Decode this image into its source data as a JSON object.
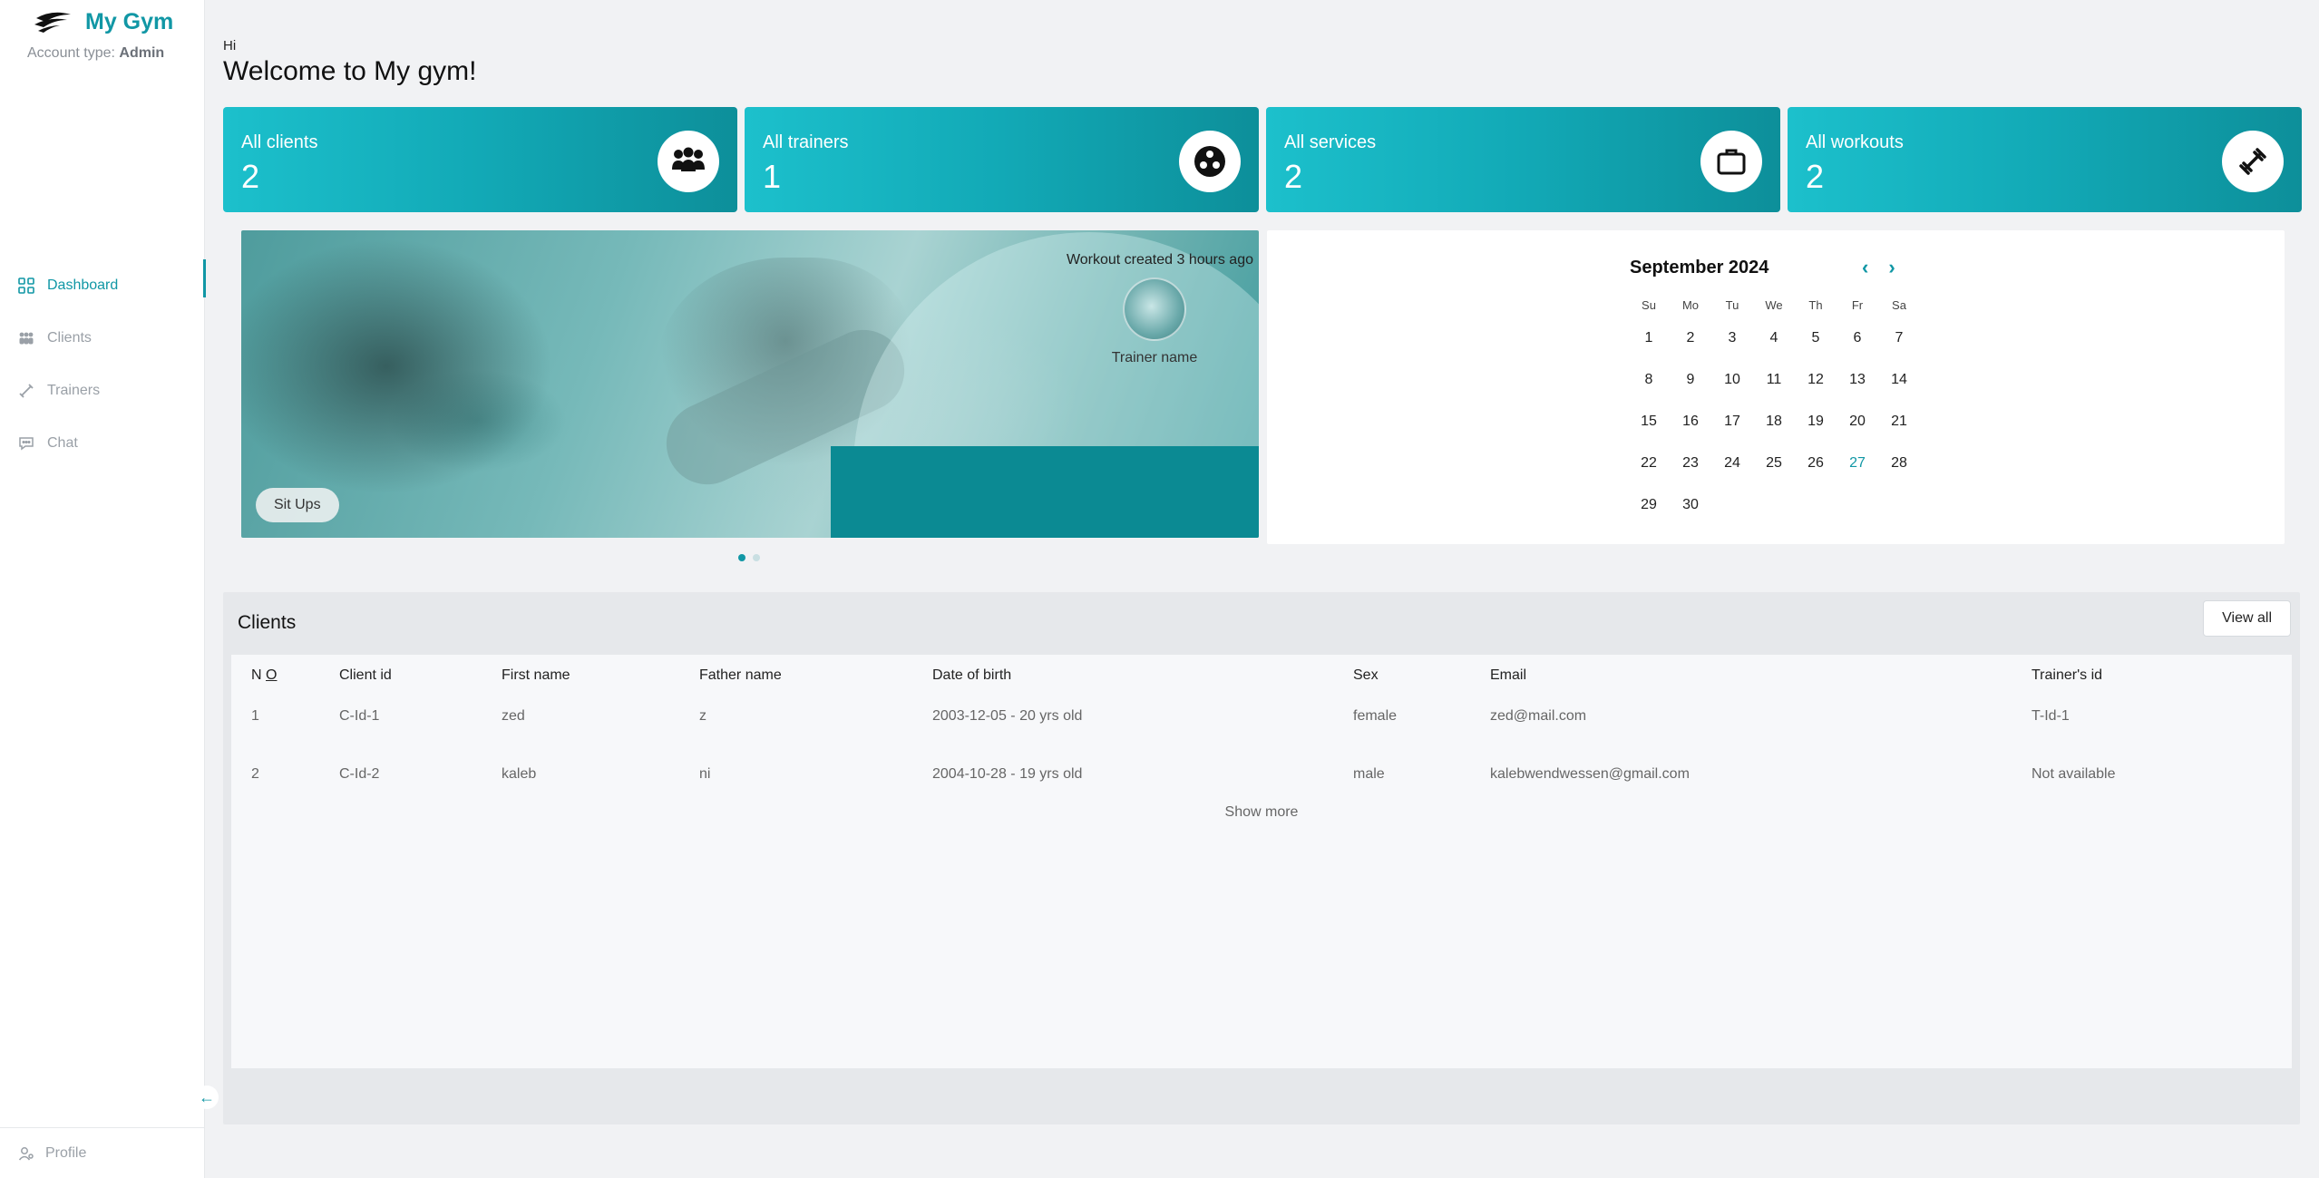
{
  "brand": {
    "title": "My Gym",
    "account_label": "Account type:",
    "account_type": "Admin"
  },
  "sidebar": {
    "items": [
      {
        "label": "Dashboard",
        "icon": "dashboard-icon",
        "active": true
      },
      {
        "label": "Clients",
        "icon": "clients-icon",
        "active": false
      },
      {
        "label": "Trainers",
        "icon": "dumbbell-icon",
        "active": false
      },
      {
        "label": "Chat",
        "icon": "chat-icon",
        "active": false
      }
    ],
    "profile_label": "Profile"
  },
  "header": {
    "greeting": "Hi",
    "welcome": "Welcome to My gym!"
  },
  "stats": [
    {
      "label": "All clients",
      "value": "2",
      "icon": "people-icon"
    },
    {
      "label": "All trainers",
      "value": "1",
      "icon": "trainer-icon"
    },
    {
      "label": "All services",
      "value": "2",
      "icon": "briefcase-icon"
    },
    {
      "label": "All workouts",
      "value": "2",
      "icon": "dumbbell-icon"
    }
  ],
  "workout_card": {
    "created": "Workout created 3 hours ago",
    "trainer_name": "Trainer name",
    "workout_name": "Sit Ups",
    "slides": 2,
    "active_slide": 1
  },
  "calendar": {
    "month_label": "September 2024",
    "weekdays": [
      "Su",
      "Mo",
      "Tu",
      "We",
      "Th",
      "Fr",
      "Sa"
    ],
    "days": [
      "1",
      "2",
      "3",
      "4",
      "5",
      "6",
      "7",
      "8",
      "9",
      "10",
      "11",
      "12",
      "13",
      "14",
      "15",
      "16",
      "17",
      "18",
      "19",
      "20",
      "21",
      "22",
      "23",
      "24",
      "25",
      "26",
      "27",
      "28",
      "29",
      "30"
    ],
    "today": "27"
  },
  "clients": {
    "title": "Clients",
    "view_all": "View all",
    "headers": {
      "no_n": "N",
      "no_o": "O",
      "client_id": "Client id",
      "first_name": "First name",
      "father_name": "Father name",
      "dob": "Date of birth",
      "sex": "Sex",
      "email": "Email",
      "trainer_id": "Trainer's id"
    },
    "rows": [
      {
        "no": "1",
        "client_id": "C-Id-1",
        "first_name": "zed",
        "father_name": "z",
        "dob": "2003-12-05 - 20 yrs old",
        "sex": "female",
        "email": "zed@mail.com",
        "trainer_id": "T-Id-1"
      },
      {
        "no": "2",
        "client_id": "C-Id-2",
        "first_name": "kaleb",
        "father_name": "ni",
        "dob": "2004-10-28 - 19 yrs old",
        "sex": "male",
        "email": "kalebwendwessen@gmail.com",
        "trainer_id": "Not available"
      }
    ],
    "show_more": "Show more"
  },
  "colors": {
    "accent": "#1197a5",
    "card_gradient_start": "#1cc0cc",
    "card_gradient_end": "#0d8f9a"
  }
}
